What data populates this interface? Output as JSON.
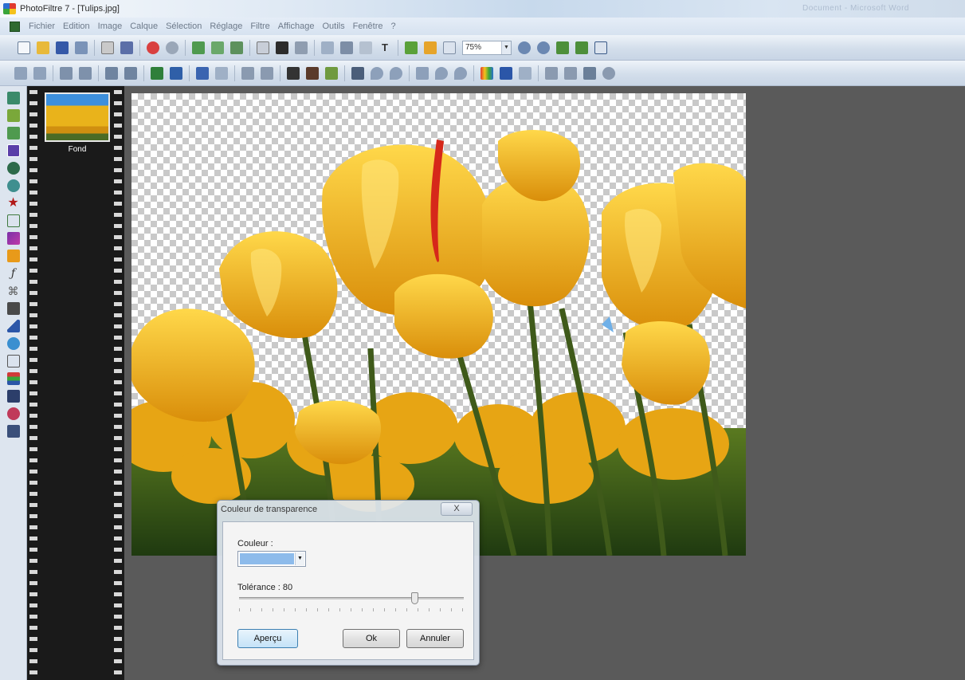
{
  "window": {
    "title": "PhotoFiltre 7 - [Tulips.jpg]",
    "right_text": "Document - Microsoft Word"
  },
  "menu": [
    "Fichier",
    "Edition",
    "Image",
    "Calque",
    "Sélection",
    "Réglage",
    "Filtre",
    "Affichage",
    "Outils",
    "Fenêtre",
    "?"
  ],
  "toolbar": {
    "zoom_value": "75%",
    "zoom_arrow": "▼"
  },
  "layers_panel": {
    "layer_name": "Fond"
  },
  "dialog": {
    "title": "Couleur de transparence",
    "close_label": "X",
    "couleur_label": "Couleur :",
    "couleur_value_color": "#8dbbeb",
    "couleur_arrow": "▼",
    "tolerance_label": "Tolérance : 80",
    "tolerance_value": 80,
    "apercu_label": "Aperçu",
    "ok_label": "Ok",
    "annuler_label": "Annuler"
  },
  "colors": {
    "workspace": "#5a5a5a",
    "tulip_yellow": "#f2b818",
    "sky_blue": "#3d8fdc",
    "stem_green": "#3f5a1a"
  }
}
